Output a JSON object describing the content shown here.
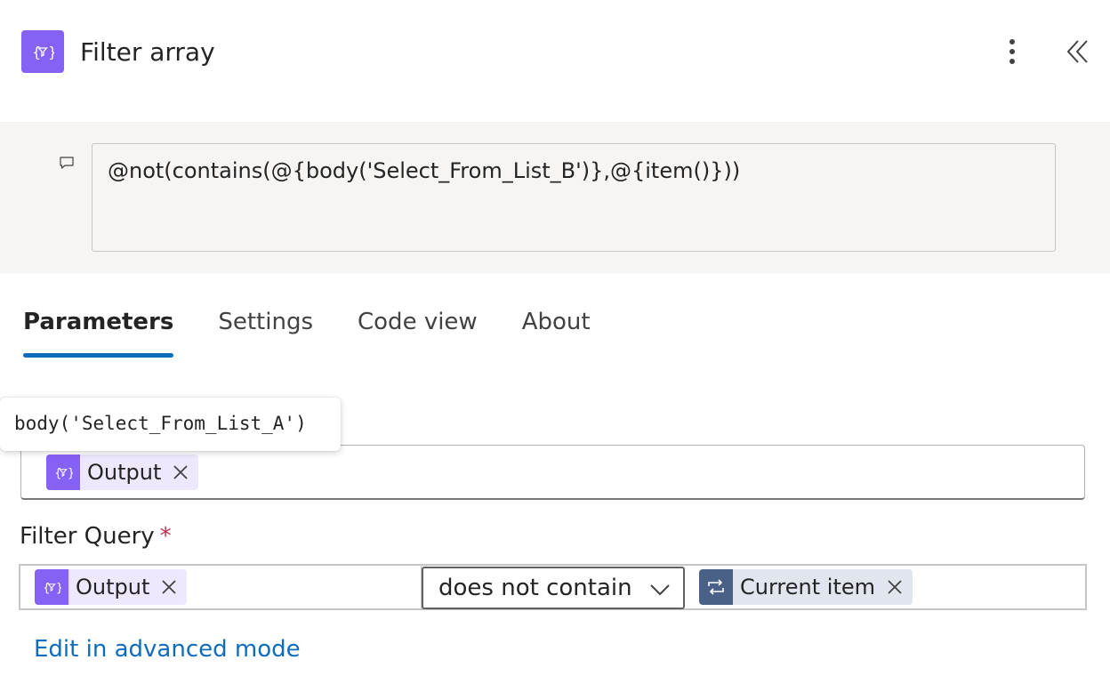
{
  "header": {
    "title": "Filter array",
    "icon": "expression-braces-icon",
    "more_icon": "more-vertical-icon",
    "collapse_icon": "double-chevron-left-icon"
  },
  "comment": {
    "icon": "comment-icon",
    "text": "@not(contains(@{body('Select_From_List_B')},@{item()}))"
  },
  "tabs": [
    {
      "label": "Parameters",
      "active": true
    },
    {
      "label": "Settings",
      "active": false
    },
    {
      "label": "Code view",
      "active": false
    },
    {
      "label": "About",
      "active": false
    }
  ],
  "from_field": {
    "tooltip": "body('Select_From_List_A')",
    "token_label": "Output"
  },
  "filter_query": {
    "label": "Filter Query",
    "required_mark": "*",
    "left_token": "Output",
    "operator": "does not contain",
    "right_token": "Current item"
  },
  "advanced_link": "Edit in advanced mode",
  "colors": {
    "accent": "#0f6cbd",
    "expression_purple": "#8661f5",
    "loop_navy": "#4a6187",
    "required_red": "#c4314b"
  }
}
